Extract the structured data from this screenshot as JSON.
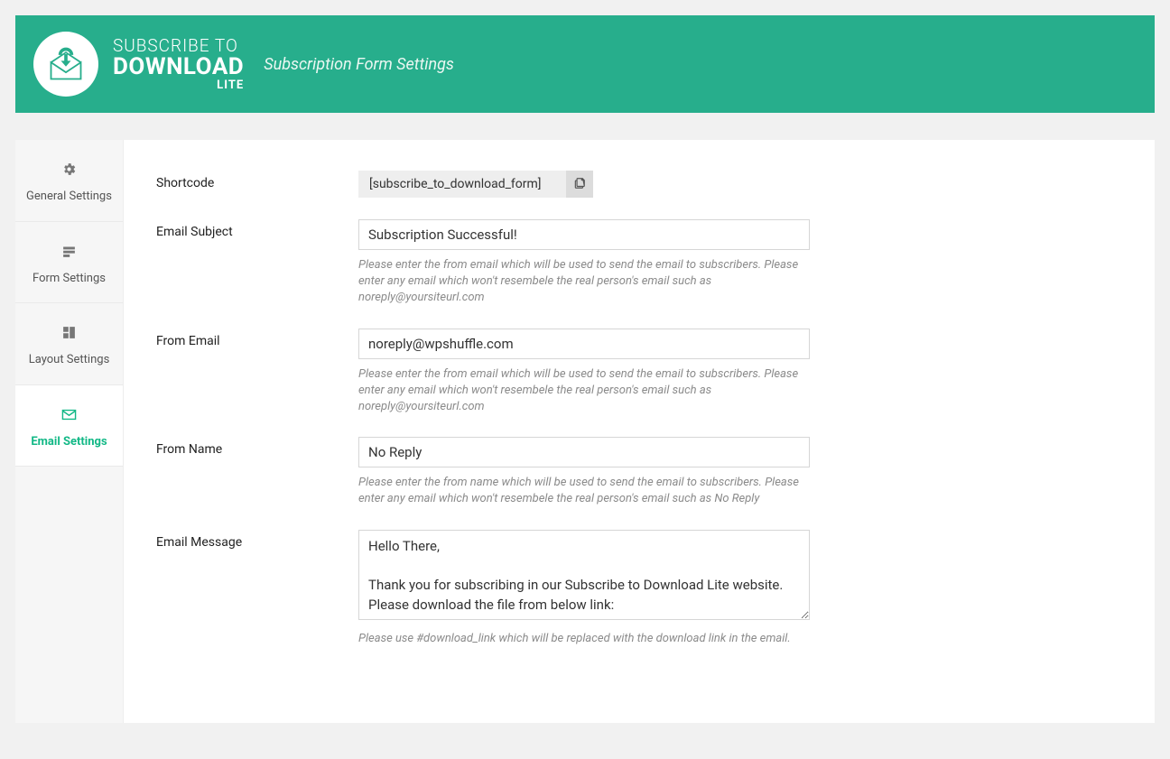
{
  "header": {
    "logo_line1": "SUBSCRIBE TO",
    "logo_line2": "DOWNLOAD",
    "logo_line3": "LITE",
    "subtitle": "Subscription Form Settings"
  },
  "sidebar": {
    "tabs": [
      {
        "label": "General Settings",
        "icon": "gear"
      },
      {
        "label": "Form Settings",
        "icon": "form"
      },
      {
        "label": "Layout Settings",
        "icon": "layout"
      },
      {
        "label": "Email Settings",
        "icon": "email"
      }
    ],
    "active_index": 3
  },
  "form": {
    "shortcode": {
      "label": "Shortcode",
      "value": "[subscribe_to_download_form]"
    },
    "email_subject": {
      "label": "Email Subject",
      "value": "Subscription Successful!",
      "help": "Please enter the from email which will be used to send the email to subscribers. Please enter any email which won't resembele the real person's email such as noreply@yoursiteurl.com"
    },
    "from_email": {
      "label": "From Email",
      "value": "noreply@wpshuffle.com",
      "help": "Please enter the from email which will be used to send the email to subscribers. Please enter any email which won't resembele the real person's email such as noreply@yoursiteurl.com"
    },
    "from_name": {
      "label": "From Name",
      "value": "No Reply",
      "help": "Please enter the from name which will be used to send the email to subscribers. Please enter any email which won't resembele the real person's email such as No Reply"
    },
    "email_message": {
      "label": "Email Message",
      "value": "Hello There,\n\nThank you for subscribing in our Subscribe to Download Lite website.\nPlease download the file from below link:",
      "help": "Please use #download_link which will be replaced with the download link in the email."
    }
  }
}
